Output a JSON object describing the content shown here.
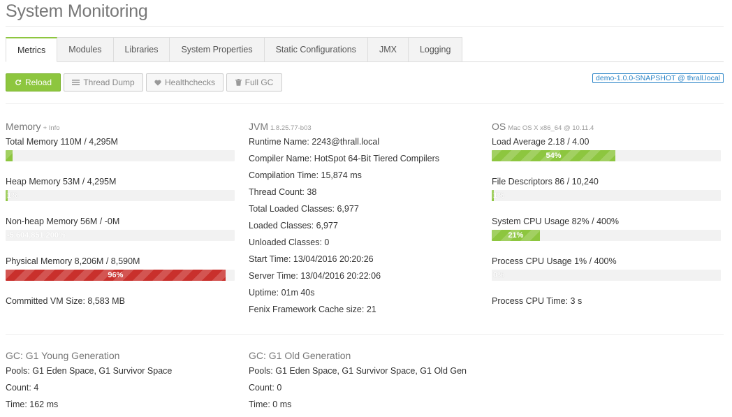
{
  "page_title": "System Monitoring",
  "tabs": [
    {
      "label": "Metrics",
      "active": true
    },
    {
      "label": "Modules",
      "active": false
    },
    {
      "label": "Libraries",
      "active": false
    },
    {
      "label": "System Properties",
      "active": false
    },
    {
      "label": "Static Configurations",
      "active": false
    },
    {
      "label": "JMX",
      "active": false
    },
    {
      "label": "Logging",
      "active": false
    }
  ],
  "toolbar": {
    "reload_label": "Reload",
    "thread_dump_label": "Thread Dump",
    "healthchecks_label": "Healthchecks",
    "full_gc_label": "Full GC"
  },
  "version_badge": "demo-1.0.0-SNAPSHOT @ thrall.local",
  "memory": {
    "title": "Memory",
    "info_link": "+ Info",
    "total": {
      "label": "Total Memory",
      "value": "110M / 4,295M",
      "percent": 3,
      "bar_text": "3%"
    },
    "heap": {
      "label": "Heap Memory",
      "value": "53M / 4,295M",
      "percent": 1,
      "bar_text": "1%"
    },
    "nonheap": {
      "label": "Non-heap Memory",
      "value": "56M / -0M",
      "percent": 0,
      "bar_text": "-5,604,851,200%"
    },
    "physical": {
      "label": "Physical Memory",
      "value": "8,206M / 8,590M",
      "percent": 96,
      "bar_text": "96%"
    },
    "committed": {
      "label": "Committed VM Size:",
      "value": "8,583 MB"
    }
  },
  "jvm": {
    "title": "JVM",
    "version": "1.8.25.77-b03",
    "rows": [
      {
        "label": "Runtime Name:",
        "value": "2243@thrall.local"
      },
      {
        "label": "Compiler Name:",
        "value": "HotSpot 64-Bit Tiered Compilers"
      },
      {
        "label": "Compilation Time:",
        "value": "15,874 ms"
      },
      {
        "label": "Thread Count:",
        "value": "38"
      },
      {
        "label": "Total Loaded Classes:",
        "value": "6,977"
      },
      {
        "label": "Loaded Classes:",
        "value": "6,977"
      },
      {
        "label": "Unloaded Classes:",
        "value": "0"
      },
      {
        "label": "Start Time:",
        "value": "13/04/2016 20:20:26"
      },
      {
        "label": "Server Time:",
        "value": "13/04/2016 20:22:06"
      },
      {
        "label": "Uptime:",
        "value": "01m 40s"
      },
      {
        "label": "Fenix Framework Cache size:",
        "value": "21"
      }
    ]
  },
  "os": {
    "title": "OS",
    "subtitle": "Mac OS X x86_64 @ 10.11.4",
    "load": {
      "label": "Load Average",
      "value": "2.18 / 4.00",
      "percent": 54,
      "bar_text": "54%"
    },
    "fd": {
      "label": "File Descriptors",
      "value": "86 / 10,240",
      "percent": 1,
      "bar_text": "1%"
    },
    "syscpu": {
      "label": "System CPU Usage",
      "value": "82% / 400%",
      "percent": 21,
      "bar_text": "21%"
    },
    "proccpu": {
      "label": "Process CPU Usage",
      "value": "1% / 400%",
      "percent": 0,
      "bar_text": "0%"
    },
    "proctime": {
      "label": "Process CPU Time:",
      "value": "3 s"
    }
  },
  "gc_young": {
    "title": "GC: G1 Young Generation",
    "pools_label": "Pools:",
    "pools": "G1 Eden Space, G1 Survivor Space",
    "count_label": "Count:",
    "count": "4",
    "time_label": "Time:",
    "time": "162 ms"
  },
  "gc_old": {
    "title": "GC: G1 Old Generation",
    "pools_label": "Pools:",
    "pools": "G1 Eden Space, G1 Survivor Space, G1 Old Gen",
    "count_label": "Count:",
    "count": "0",
    "time_label": "Time:",
    "time": "0 ms"
  },
  "colors": {
    "accent": "#8dc63f",
    "danger": "#c9302c",
    "badge": "#2a84c7"
  }
}
